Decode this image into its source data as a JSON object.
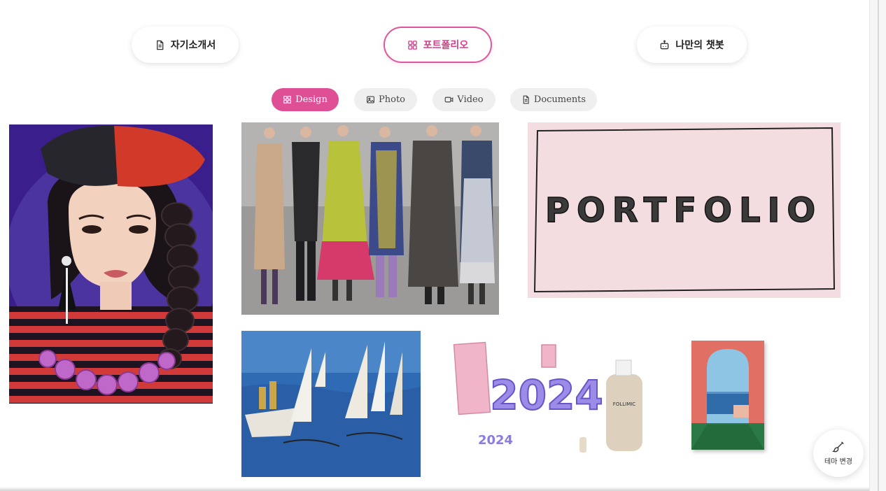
{
  "main_tabs": [
    {
      "label": "자기소개서",
      "icon": "document-icon"
    },
    {
      "label": "포트폴리오",
      "icon": "grid-icon",
      "active": true
    },
    {
      "label": "나만의 챗봇",
      "icon": "bot-icon"
    }
  ],
  "sub_tabs": [
    {
      "label": "Design",
      "icon": "grid-icon",
      "active": true
    },
    {
      "label": "Photo",
      "icon": "image-icon"
    },
    {
      "label": "Video",
      "icon": "video-icon"
    },
    {
      "label": "Documents",
      "icon": "document-icon"
    }
  ],
  "gallery": {
    "portfolio_art_text": "PORTFOLIO",
    "art_2024_text": "2024",
    "bottle_label": "FOLLIMIC"
  },
  "theme_button": {
    "label": "테마 변경",
    "icon": "paintbrush-icon"
  },
  "colors": {
    "accent": "#de4f95",
    "accent_text": "#d63d89",
    "chip_bg": "#efefef"
  }
}
